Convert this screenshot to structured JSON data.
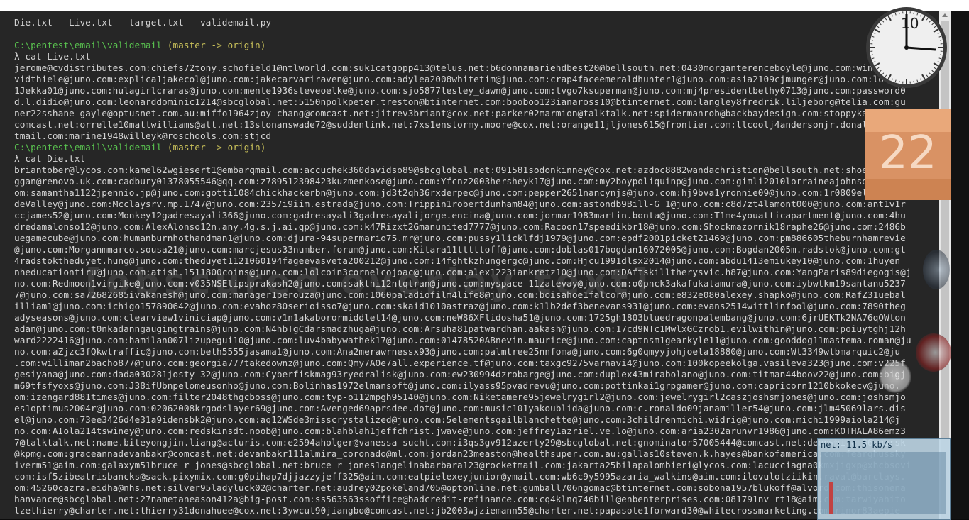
{
  "terminal": {
    "lines": [
      "Die.txt   Live.txt   target.txt   validemail.py",
      "",
      "C:\\pentest\\email\\validemail (master -> origin)",
      "λ cat Live.txt",
      "jerome@cvdistributes.com:chiefs72tony.schofield1@ntlworld.com:suk1catgopp413@telus.net:b6donnamariehdbest20@bellsouth.net:0430morganterenceboyle@juno.com:windscr10",
      "vidthiele@juno.com:explica1jakecol@juno.com:jakecarvariraven@juno.com:adylea2008whitetim@juno.com:crap4faceemeraldhunter1@juno.com:asia2109cjmunger@juno.com:lovesu",
      "1Jekka01@juno.com:hulagirlcraras@juno.com:mente1936steveoelke@juno.com:sjo5877lesley_dawn@juno.com:tvgo7ksuperman@juno.com:mj4presidentbethy0713@juno.com:password0",
      "d.l.didio@juno.com:leonarddominic1214@sbcglobal.net:5150npolkpeter.treston@btinternet.com:booboo123ianaross10@btinternet.com:langley8fredrik.liljeborg@telia.com:gu",
      "ner22sshane_gayle@optusnet.com.au:miffo1964zjoy_chang@comcast.net:jitrev3briant@cox.net:parker02marmion@talktalk.net:spidermanrob@backbaydesign.com:stoppykatiereto",
      "comcast.net:orrelle10mattwilliams@att.net:13stonanswade72@suddenlink.net:7xs1enstormy.moore@cox.net:orange11jljones615@frontier.com:llcoolj4andersonjr.donald@rock",
      "tmail.com:marine1948willeyk@roschools.com:stjcd",
      "C:\\pentest\\email\\validemail (master -> origin)",
      "λ cat Die.txt",
      "briantober@lycos.com:kamel62wgiesert1@embarqmail.com:accuchek360davidso89@sbcglobal.net:091581sodonkinney@cox.net:azdoc8882wandachristion@bellsouth.net:shoesnow1fd",
      "ggan@renovo.uk.com:cadbury01378055546@qq.com:z789512398423kuzmenkose@juno.com:Yfcnz2003hersheyk17@juno.com:my2boypoliquinp@juno.com:gimli2010lorraineajohnson@juno.",
      "om:samantha1122jpennio.jp@juno.com:gotti1084chickhackerbn@juno.com:jd3t2qh36rxderpec@juno.com:pepper2651nancynjs@juno.com:hj9bva1yronnie09@juno.com:1r0809elleve",
      "deValley@juno.com:Mcclaysrv.mp.1747@juno.com:2357i9iim.estrada@juno.com:Trippin1robertdunham84@juno.com:astondb9Bill-G_1@juno.com:c8d7zt4lamont000@juno.com:ant1v1r",
      "ccjames52@juno.com:Monkey12gadresayali366@juno.com:gadresayali3gadresayalijorge.encina@juno.com:jormar1983martin.bonta@juno.com:T1me4youatticapartment@juno.com:4hu",
      "dredamalonso12@juno.com:AlexAlonso12n.any.4g.s.j.ai.qp@juno.com:k47Rizxt2Gmanunited7777@juno.com:Racoon17speedikbr18@juno.com:Shockmazornik18raphe26@juno.com:2486b",
      "uegamecube@juno.com:humanburnhothandman1@juno.com:djura-94supermario75.mr@juno.com:pussy1licklfdj1979@juno.com:epdf2001picket21469@juno.com:pm886605theburnhamrevie",
      "@juno.com:Morganmmarco.sousa21@juno.com:marcjesus33number.forum@juno.com:Kitara11tttttoff@juno.com:doblas017bogdan16072005@juno.com:Bogdan2005m.radstok@juno.com:gt",
      "4radstoktheduyet.hung@juno.com:theduyet1121060194fageevasveta200212@juno.com:14fghtkzhungergc@juno.com:Hjcu1991dlsx2014@juno.com:abdu1413emiukey10@juno.com:1huyen",
      "nheducationtiru@juno.com:atish.1511800coins@juno.com:lolcoin3cornelcojoac@juno.com:alex1223iankretz10@juno.com:DAftskilltherysvic.h87@juno.com:YangParis89diegogis@j",
      "no.com:Redmoon1virgike@juno.com:v035NSElipsprakash2@juno.com:sakthi12ntqtran@juno.com:myspace-11zatevay@juno.com:o0pnck3akafukatamura@juno.com:iybwtkm19santanu5237",
      "7@juno.com:sa72682685ivakanesh@juno.com:manager1perouza@juno.com:1060paladiofilm4life8@juno.com:boisahoe1falcor@juno.com:e832e080alexey.shapko@juno.com:RafZ31uebal",
      "illiam1@juno.com:ichigo157890642@juno.com:evahoz80serioisso7@juno.com:skaid1010astraz@juno.com:k1lb2def3benevans931@juno.com:evans2514wittlinfool@juno.com:7890theg",
      "adyseasons@juno.com:clearview1viniciap@juno.com:v1n1akaborormiddlet14@juno.com:neW86XFlidosha51@juno.com:1725gh1803bluedragonpalembang@juno.com:6jrUEKTk2NA76qQWton",
      "adan@juno.com:t0nkadanngaugingtrains@juno.com:N4hbTgCdarsmadzhuga@juno.com:Arsuha81patwardhan.aakash@juno.com:17cd9NTc1MwlxGCzrob1.evilwithin@juno.com:poiuytghj12h",
      "ward2222416@juno.com:hamilan007lizupegui10@juno.com:luv4babywathek17@juno.com:01478520ABnevin.maurice@juno.com:captnsm1gearkyle11@juno.com:gooddog11mastema.roman@ju",
      "no.com:aZjzc3fQkwtraffic@juno.com:beth5555jasama1@juno.com:Ana2merawrnessx93@juno.com:palmtree25nnfoma@juno.com:6g0qmyyjohjoela18880@juno.com:Wt3349wtbmarquic2@ju",
      ".com:williman2bacho877@juno.com:georgia777takedownz@juno.com:Qmy7A0e7all.experience.tf@juno.com:taxgc9275varnavi4@juno.com:100kopeekolga.vasileva323@juno.com:v225f",
      "gesiyana@juno.com:dada030281josty-32@juno.com:Cyberfiskmag93ryedralisk@juno.com:ew230994dzrobarge@juno.com:duplex43mirabolano@juno.com:titman44boov22@juno.com:bigj",
      "m69tfsfyoxs@juno.com:J38ifUbnpelomeusonho@juno.com:Bolinhas1972elmansoft@juno.com:ilyass95pvadrevu@juno.com:pottinkai1grpgamer@juno.com:capricorn1210bkokecv@juno.",
      "om:izengard881times@juno.com:filter2048thgcboss@juno.com:typ-o112mpgh95140@juno.com:Niketamere95jewelrygirl2@juno.com:jewelrygirl2caszjoshsmjones@juno.com:joshsmjo",
      "es1optimus2004r@juno.com:02062008krgodslayer69@juno.com:Avenged69aprsdee.dot@juno.com:music101yakoublida@juno.com:c.ronaldo09janamiller54@juno.com:jlm45069lars.dis",
      "el@juno.com:73ee3426d4e31a9idensbk2@juno.com:aq12WSde3misscrystalized@juno.com:5elementsgailblanchette@juno.com:3childrenmichi.widrig@juno.com:michi1999aiola214@j",
      "no.com:AIola214tswiney@juno.com:redskinsdt.noob@juno.com:blahblah1jeffchrist.jwave@juno.com:jeffrey1azriel.ve.lo@juno.com:aria2302arunvr1986@juno.com:KOTHALA86emz3",
      "7@talktalk.net:name.biteyongjin.liang@acturis.com:e2594aholger@vanessa-sucht.com:i3qs3gv912azerty29@sbcglobal.net:gnominator57005444@comcast.net:deepwhite_86agorsk",
      "@kpmg.com:graceannadevanbakr@comcast.net:devanbakr111almira_coronado@ml.com:jordan23measton@healthsuper.com.au:gallas10steven.k.hayes@bankofamerica.com:fearghussky",
      "iverm51@aim.com:galaxym51bruce_r_jones@sbcglobal.net:bruce_r_jones1angelinabarbara123@rocketmail.com:jakarta25bilapalombieri@lycos.com:lacucciagna0kmxjigxp@xhcbsovi",
      "com:isf5zibeatrisbancks@sack.pixymix.com:g0pihap7djjazzyjeff325@aim.com:eatpielexeyjunior@ymail.com:wb6c9y5995azaria_walkins@aim.com:ilovulotziikin.raval@barclays.",
      "om:45260cazra.eidha@nhs.net:silver95ladyluck02@charter.net:audrey02pokeland705@optonline.net:gumball706ngomac@btinternet.com:sobona1957blukoff@alvord.com:thisonena",
      "hanvance@sbcglobal.net:27nametaneason412a@big-post.com:ss563563ssoffice@badcredit-refinance.com:cq4klnq746bill@enbenterprises.com:081791nv_rt18@aim.com:tarwiyahito",
      "lzethierry@charter.net:thierry31donahuee@cox.net:3ywcut90jiangbo@comcast.net:jb2003wjziemann55@charter.net:papasote1forward30@whitecrossmarketing.com:rinor83aepie"
    ],
    "watermark_text": "[obscured overlay text]"
  },
  "clock": {
    "number_text": "10",
    "color_face": "#f2f2f2"
  },
  "calendar": {
    "day_number": "22"
  },
  "net_meter": {
    "header_text": "net: 11.5 kb/s"
  },
  "colors": {
    "terminal_bg": "#262626",
    "text": "#d4d4d4",
    "path_green": "#59c24f",
    "branch_yellow": "#c9c15a"
  }
}
